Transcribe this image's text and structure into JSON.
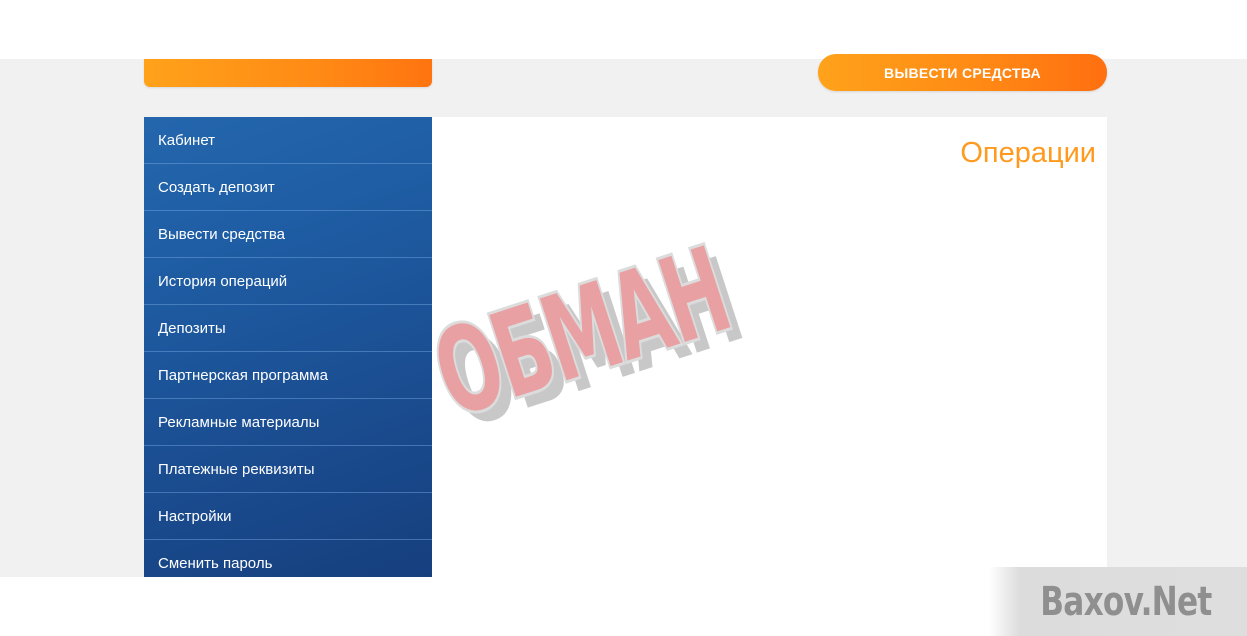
{
  "header": {
    "withdraw_button_label": "ВЫВЕСТИ СРЕДСТВА"
  },
  "sidebar": {
    "items": [
      {
        "label": "Кабинет"
      },
      {
        "label": "Создать депозит"
      },
      {
        "label": "Вывести средства"
      },
      {
        "label": "История операций"
      },
      {
        "label": "Депозиты"
      },
      {
        "label": "Партнерская программа"
      },
      {
        "label": "Рекламные материалы"
      },
      {
        "label": "Платежные реквизиты"
      },
      {
        "label": "Настройки"
      },
      {
        "label": "Сменить пароль"
      }
    ]
  },
  "main": {
    "title": "Операции"
  },
  "overlay": {
    "stamp_text": "ОБМАН",
    "watermark_text": "Baxov.Net"
  },
  "colors": {
    "accent_orange": "#ff8a15",
    "sidebar_blue": "#1f5ea5",
    "title_orange": "#ff9a1e"
  }
}
